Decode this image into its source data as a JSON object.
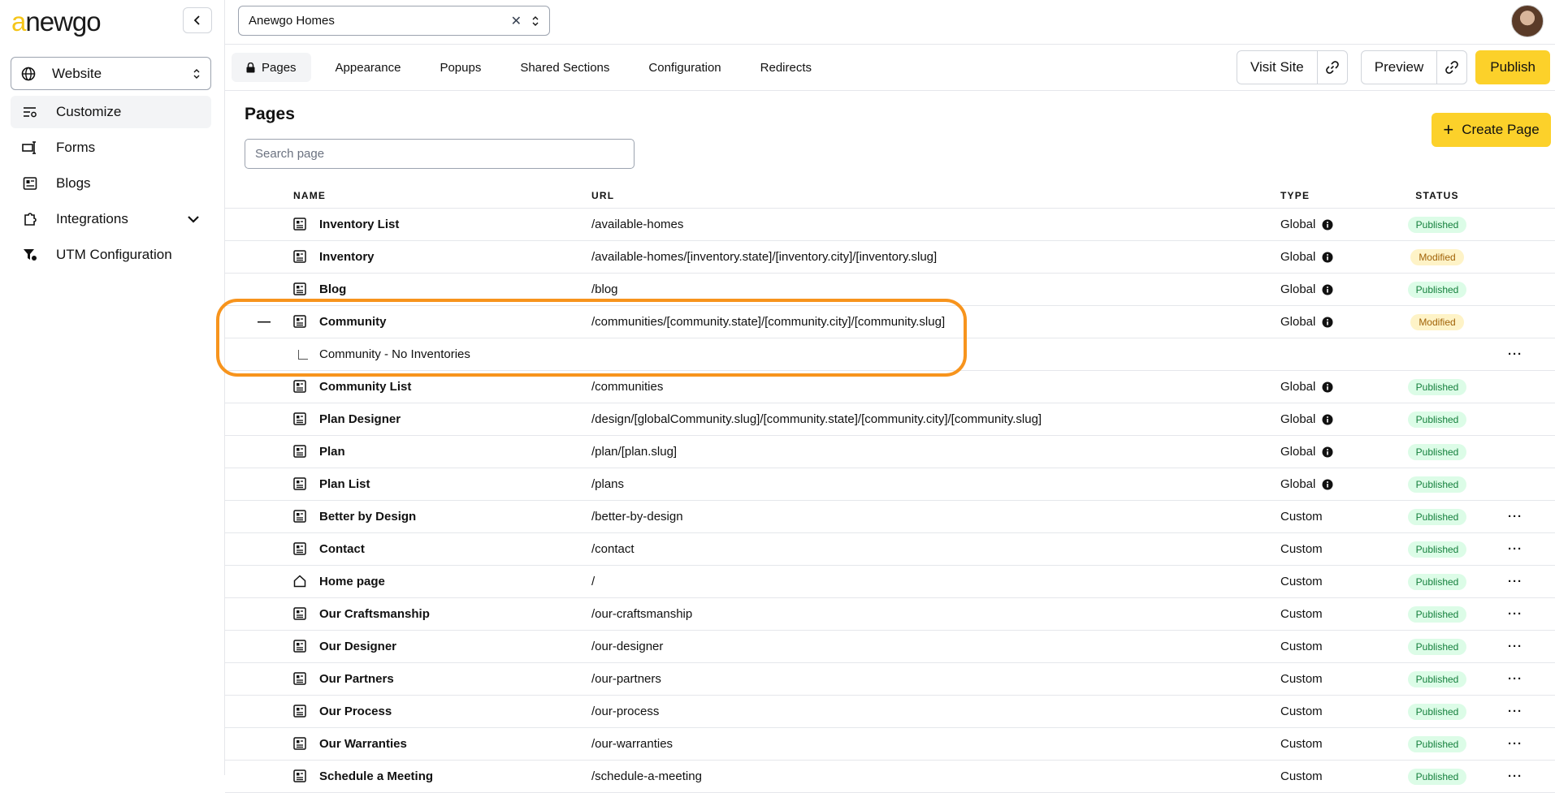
{
  "brand": {
    "logo_a": "a",
    "logo_b": "newgo"
  },
  "sidebar": {
    "site_select": {
      "label": "Website"
    },
    "items": [
      {
        "label": "Customize",
        "icon": "customize-icon",
        "active": true
      },
      {
        "label": "Forms",
        "icon": "forms-icon"
      },
      {
        "label": "Blogs",
        "icon": "blogs-icon"
      },
      {
        "label": "Integrations",
        "icon": "puzzle-icon",
        "has_chevron": true
      },
      {
        "label": "UTM Configuration",
        "icon": "filter-icon"
      }
    ]
  },
  "topbar": {
    "company": "Anewgo Homes"
  },
  "tabs": [
    {
      "label": "Pages",
      "active": true
    },
    {
      "label": "Appearance"
    },
    {
      "label": "Popups"
    },
    {
      "label": "Shared Sections"
    },
    {
      "label": "Configuration"
    },
    {
      "label": "Redirects"
    }
  ],
  "actions": {
    "visit_site": "Visit Site",
    "preview": "Preview",
    "publish": "Publish"
  },
  "content": {
    "title": "Pages",
    "create_label": "Create Page",
    "search_placeholder": "Search page"
  },
  "table": {
    "headers": {
      "name": "NAME",
      "url": "URL",
      "type": "TYPE",
      "status": "STATUS"
    },
    "rows": [
      {
        "name": "Inventory List",
        "url": "/available-homes",
        "type": "Global",
        "status": "Published"
      },
      {
        "name": "Inventory",
        "url": "/available-homes/[inventory.state]/[inventory.city]/[inventory.slug]",
        "type": "Global",
        "status": "Modified"
      },
      {
        "name": "Blog",
        "url": "/blog",
        "type": "Global",
        "status": "Published"
      },
      {
        "name": "Community",
        "url": "/communities/[community.state]/[community.city]/[community.slug]",
        "type": "Global",
        "status": "Modified",
        "expanded": true
      },
      {
        "name": "Community - No Inventories",
        "sub": true,
        "more": "···"
      },
      {
        "name": "Community List",
        "url": "/communities",
        "type": "Global",
        "status": "Published"
      },
      {
        "name": "Plan Designer",
        "url": "/design/[globalCommunity.slug]/[community.state]/[community.city]/[community.slug]",
        "type": "Global",
        "status": "Published"
      },
      {
        "name": "Plan",
        "url": "/plan/[plan.slug]",
        "type": "Global",
        "status": "Published"
      },
      {
        "name": "Plan List",
        "url": "/plans",
        "type": "Global",
        "status": "Published"
      },
      {
        "name": "Better by Design",
        "url": "/better-by-design",
        "type": "Custom",
        "status": "Published",
        "more": "···"
      },
      {
        "name": "Contact",
        "url": "/contact",
        "type": "Custom",
        "status": "Published",
        "more": "···"
      },
      {
        "name": "Home page",
        "url": "/",
        "type": "Custom",
        "status": "Published",
        "more": "···",
        "home": true
      },
      {
        "name": "Our Craftsmanship",
        "url": "/our-craftsmanship",
        "type": "Custom",
        "status": "Published",
        "more": "···"
      },
      {
        "name": "Our Designer",
        "url": "/our-designer",
        "type": "Custom",
        "status": "Published",
        "more": "···"
      },
      {
        "name": "Our Partners",
        "url": "/our-partners",
        "type": "Custom",
        "status": "Published",
        "more": "···"
      },
      {
        "name": "Our Process",
        "url": "/our-process",
        "type": "Custom",
        "status": "Published",
        "more": "···"
      },
      {
        "name": "Our Warranties",
        "url": "/our-warranties",
        "type": "Custom",
        "status": "Published",
        "more": "···"
      },
      {
        "name": "Schedule a Meeting",
        "url": "/schedule-a-meeting",
        "type": "Custom",
        "status": "Published",
        "more": "···"
      }
    ]
  },
  "colors": {
    "accent": "#fcd12a",
    "highlight": "#f7941d",
    "published_bg": "#dcfce7",
    "modified_bg": "#fef3c7"
  }
}
